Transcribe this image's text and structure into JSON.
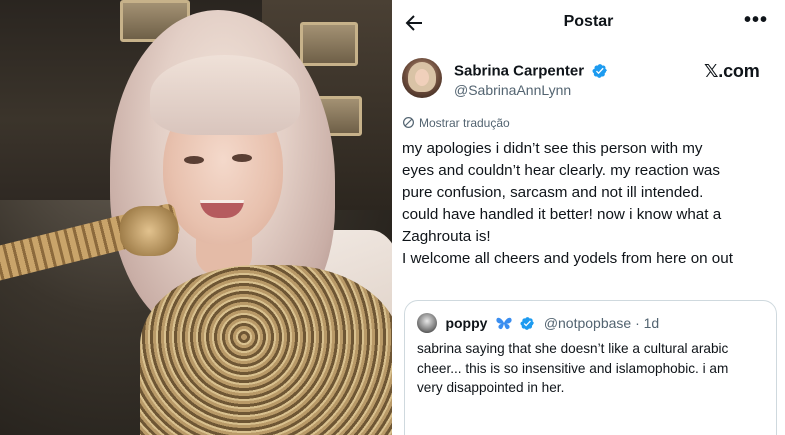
{
  "header": {
    "title": "Postar",
    "back_icon": "arrow-left-icon",
    "more_label": "•••"
  },
  "author": {
    "display_name": "Sabrina Carpenter",
    "handle": "@SabrinaAnnLynn",
    "verified_icon": "verified-badge-icon",
    "verified_color": "#1d9bf0"
  },
  "watermark": "𝕏.com",
  "translate": {
    "label": "Mostrar tradução",
    "icon": "translate-globe-icon"
  },
  "tweet": {
    "lines": [
      "my apologies i didn’t see this person with my",
      "eyes and couldn’t hear clearly. my reaction was",
      "pure confusion, sarcasm and not ill intended.",
      "could have handled it better! now i know what a",
      "Zaghrouta is!",
      "I welcome all cheers and yodels from here on out"
    ]
  },
  "quote": {
    "display_name": "poppy",
    "butterfly_icon": "blue-butterfly-icon",
    "handle_time": "@notpopbase · 1d",
    "lines": [
      "sabrina saying that she doesn’t like a cultural arabic",
      "cheer... this is so insensitive and islamophobic. i am",
      "very disappointed in her."
    ]
  },
  "colors": {
    "text_primary": "#0f1419",
    "text_secondary": "#536471",
    "accent_blue": "#1d9bf0",
    "border": "#cfd9de"
  }
}
